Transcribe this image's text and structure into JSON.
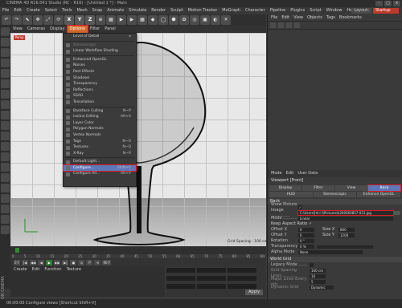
{
  "window": {
    "title": "CINEMA 4D R16.041 Studio (RC - R16) - [Untitled 1 *] - Main"
  },
  "menubar": {
    "items": [
      "File",
      "Edit",
      "Create",
      "Select",
      "Tools",
      "Mesh",
      "Snap",
      "Animate",
      "Simulate",
      "Render",
      "Sculpt",
      "Motion Tracker",
      "MoGraph",
      "Character",
      "Pipeline",
      "Plugins",
      "Script",
      "Window",
      "Help"
    ],
    "layout_label": "Layout:",
    "layout_value": "Startup"
  },
  "toolbar": {
    "buttons": [
      "↶",
      "↷",
      "⬉",
      "✥",
      "⤢",
      "⟳",
      "X",
      "Y",
      "Z",
      "⊕",
      "▦",
      "▶",
      "▶",
      "▦",
      "◆",
      "◯",
      "⬢",
      "✿",
      "◎",
      "▣",
      "◐",
      "☀"
    ]
  },
  "viewport_menu": {
    "items": [
      "View",
      "Cameras",
      "Display",
      "Options",
      "Filter",
      "Panel"
    ],
    "active_index": 3,
    "badge": "Persp"
  },
  "viewport": {
    "grid_spacing_label": "Grid Spacing : 100 cm"
  },
  "options_menu": {
    "items": [
      {
        "label": "Level of Detail",
        "shortcut": "",
        "type": "arrow"
      },
      {
        "type": "sep"
      },
      {
        "label": "Stereoscopic",
        "shortcut": "",
        "type": "disabled"
      },
      {
        "label": "Linear Workflow Shading",
        "shortcut": "",
        "type": "icon"
      },
      {
        "type": "sep"
      },
      {
        "label": "Enhanced OpenGL",
        "shortcut": "",
        "type": "icon"
      },
      {
        "label": "Noises",
        "shortcut": "",
        "type": "icon"
      },
      {
        "label": "Post Effects",
        "shortcut": "",
        "type": "icon"
      },
      {
        "label": "Shadows",
        "shortcut": "",
        "type": "icon"
      },
      {
        "label": "Transparency",
        "shortcut": "",
        "type": "icon"
      },
      {
        "label": "Reflections",
        "shortcut": "",
        "type": "icon"
      },
      {
        "label": "SSAO",
        "shortcut": "",
        "type": "icon"
      },
      {
        "label": "Tessellation",
        "shortcut": "",
        "type": "icon"
      },
      {
        "type": "sep"
      },
      {
        "label": "Backface Culling",
        "shortcut": "N~P",
        "type": "icon"
      },
      {
        "label": "Isoline Editing",
        "shortcut": "Alt+A",
        "type": "icon"
      },
      {
        "label": "Layer Color",
        "shortcut": "",
        "type": "icon"
      },
      {
        "label": "Polygon Normals",
        "shortcut": "",
        "type": "icon"
      },
      {
        "label": "Vertex Normals",
        "shortcut": "",
        "type": "icon"
      },
      {
        "label": "Tags",
        "shortcut": "N~O",
        "type": "icon"
      },
      {
        "label": "Textures",
        "shortcut": "N~Q",
        "type": "icon"
      },
      {
        "label": "X-Ray",
        "shortcut": "N~R",
        "type": "icon"
      },
      {
        "type": "sep"
      },
      {
        "label": "Default Light...",
        "shortcut": "",
        "type": "icon"
      },
      {
        "label": "Configure...",
        "shortcut": "Shift+V",
        "type": "highlight"
      },
      {
        "label": "Configure All...",
        "shortcut": "Alt+V",
        "type": "icon"
      }
    ]
  },
  "timeline": {
    "ticks": [
      "0",
      "5",
      "10",
      "15",
      "20",
      "25",
      "30",
      "35",
      "40",
      "45",
      "50",
      "55",
      "60",
      "65",
      "70",
      "75",
      "80",
      "85",
      "90"
    ],
    "start": "0 F",
    "end": "90 F"
  },
  "playback": {
    "buttons": [
      "|◀",
      "◀◀",
      "◀",
      "▶",
      "▶▶",
      "▶|",
      "●",
      "◎",
      "P",
      "⟲"
    ]
  },
  "material_menu": {
    "items": [
      "Create",
      "Edit",
      "Function",
      "Texture"
    ]
  },
  "coord_panel": {
    "apply_label": "Apply"
  },
  "status": {
    "text": "00:00:00    Configure views [Shortcut Shift+V]"
  },
  "object_panel": {
    "menu": [
      "File",
      "Edit",
      "View",
      "Objects",
      "Tags",
      "Bookmarks"
    ]
  },
  "attributes": {
    "menu": [
      "Mode",
      "Edit",
      "User Data"
    ],
    "title": "Viewport [Front]",
    "tabs_row1": [
      "Display",
      "Filter",
      "View",
      "Back"
    ],
    "tabs_row2": [
      "HUD",
      "Stereoscopic",
      "Enhance OpenGL"
    ],
    "active_tab": "Back",
    "section_back": "Back",
    "show_picture_label": "Show Picture .........",
    "show_picture_value": "✓",
    "image_label": "Image ...............",
    "image_value": "C:\\Users\\[마ㅇ]\\Pictures\\k2005K0857-021.jpg",
    "mode_label": "Mode ...........",
    "mode_value": "Linear",
    "keep_aspect_label": "Keep Aspect Ratio ✓",
    "offx_label": "Offset X",
    "offx_value": "0",
    "offy_label": "Offset Y",
    "offy_value": "0",
    "sizex_label": "Size X",
    "sizex_value": "800",
    "sizey_label": "Size Y",
    "sizey_value": "1200",
    "rotation_label": "Rotation",
    "rotation_value": "0 °",
    "transparency_label": "Transparency",
    "transparency_value": "0 %",
    "alpha_label": "Alpha Mode",
    "alpha_value": "None",
    "section_world": "World Grid",
    "legacy_label": "Legacy Mode .......",
    "grid_spacing_label": "Grid Spacing",
    "grid_spacing_value": "100 cm",
    "lines_label": "Lines ...........",
    "lines_value": "10",
    "major_label": "Major Lines Every nth",
    "major_value": "5",
    "dynamic_label": "Dynamic Grid",
    "dynamic_value": "Dynamic"
  }
}
